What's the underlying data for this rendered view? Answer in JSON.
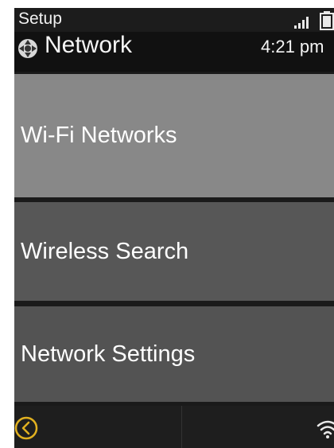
{
  "status_bar": {
    "title": "Setup",
    "signal_icon": "signal-bars-icon",
    "battery_icon": "battery-icon"
  },
  "header": {
    "icon": "network-icon",
    "title": "Network",
    "clock": "4:21 pm"
  },
  "menu": {
    "items": [
      {
        "label": "Wi-Fi Networks",
        "selected": true
      },
      {
        "label": "Wireless Search",
        "selected": false
      },
      {
        "label": "Network Settings",
        "selected": false
      }
    ]
  },
  "footer": {
    "back_icon": "back-chevron-icon",
    "wifi_icon": "wifi-icon"
  },
  "colors": {
    "accent": "#e0b020",
    "selected_item": "#888888",
    "item": "#575757",
    "background": "#1a1a1a"
  }
}
